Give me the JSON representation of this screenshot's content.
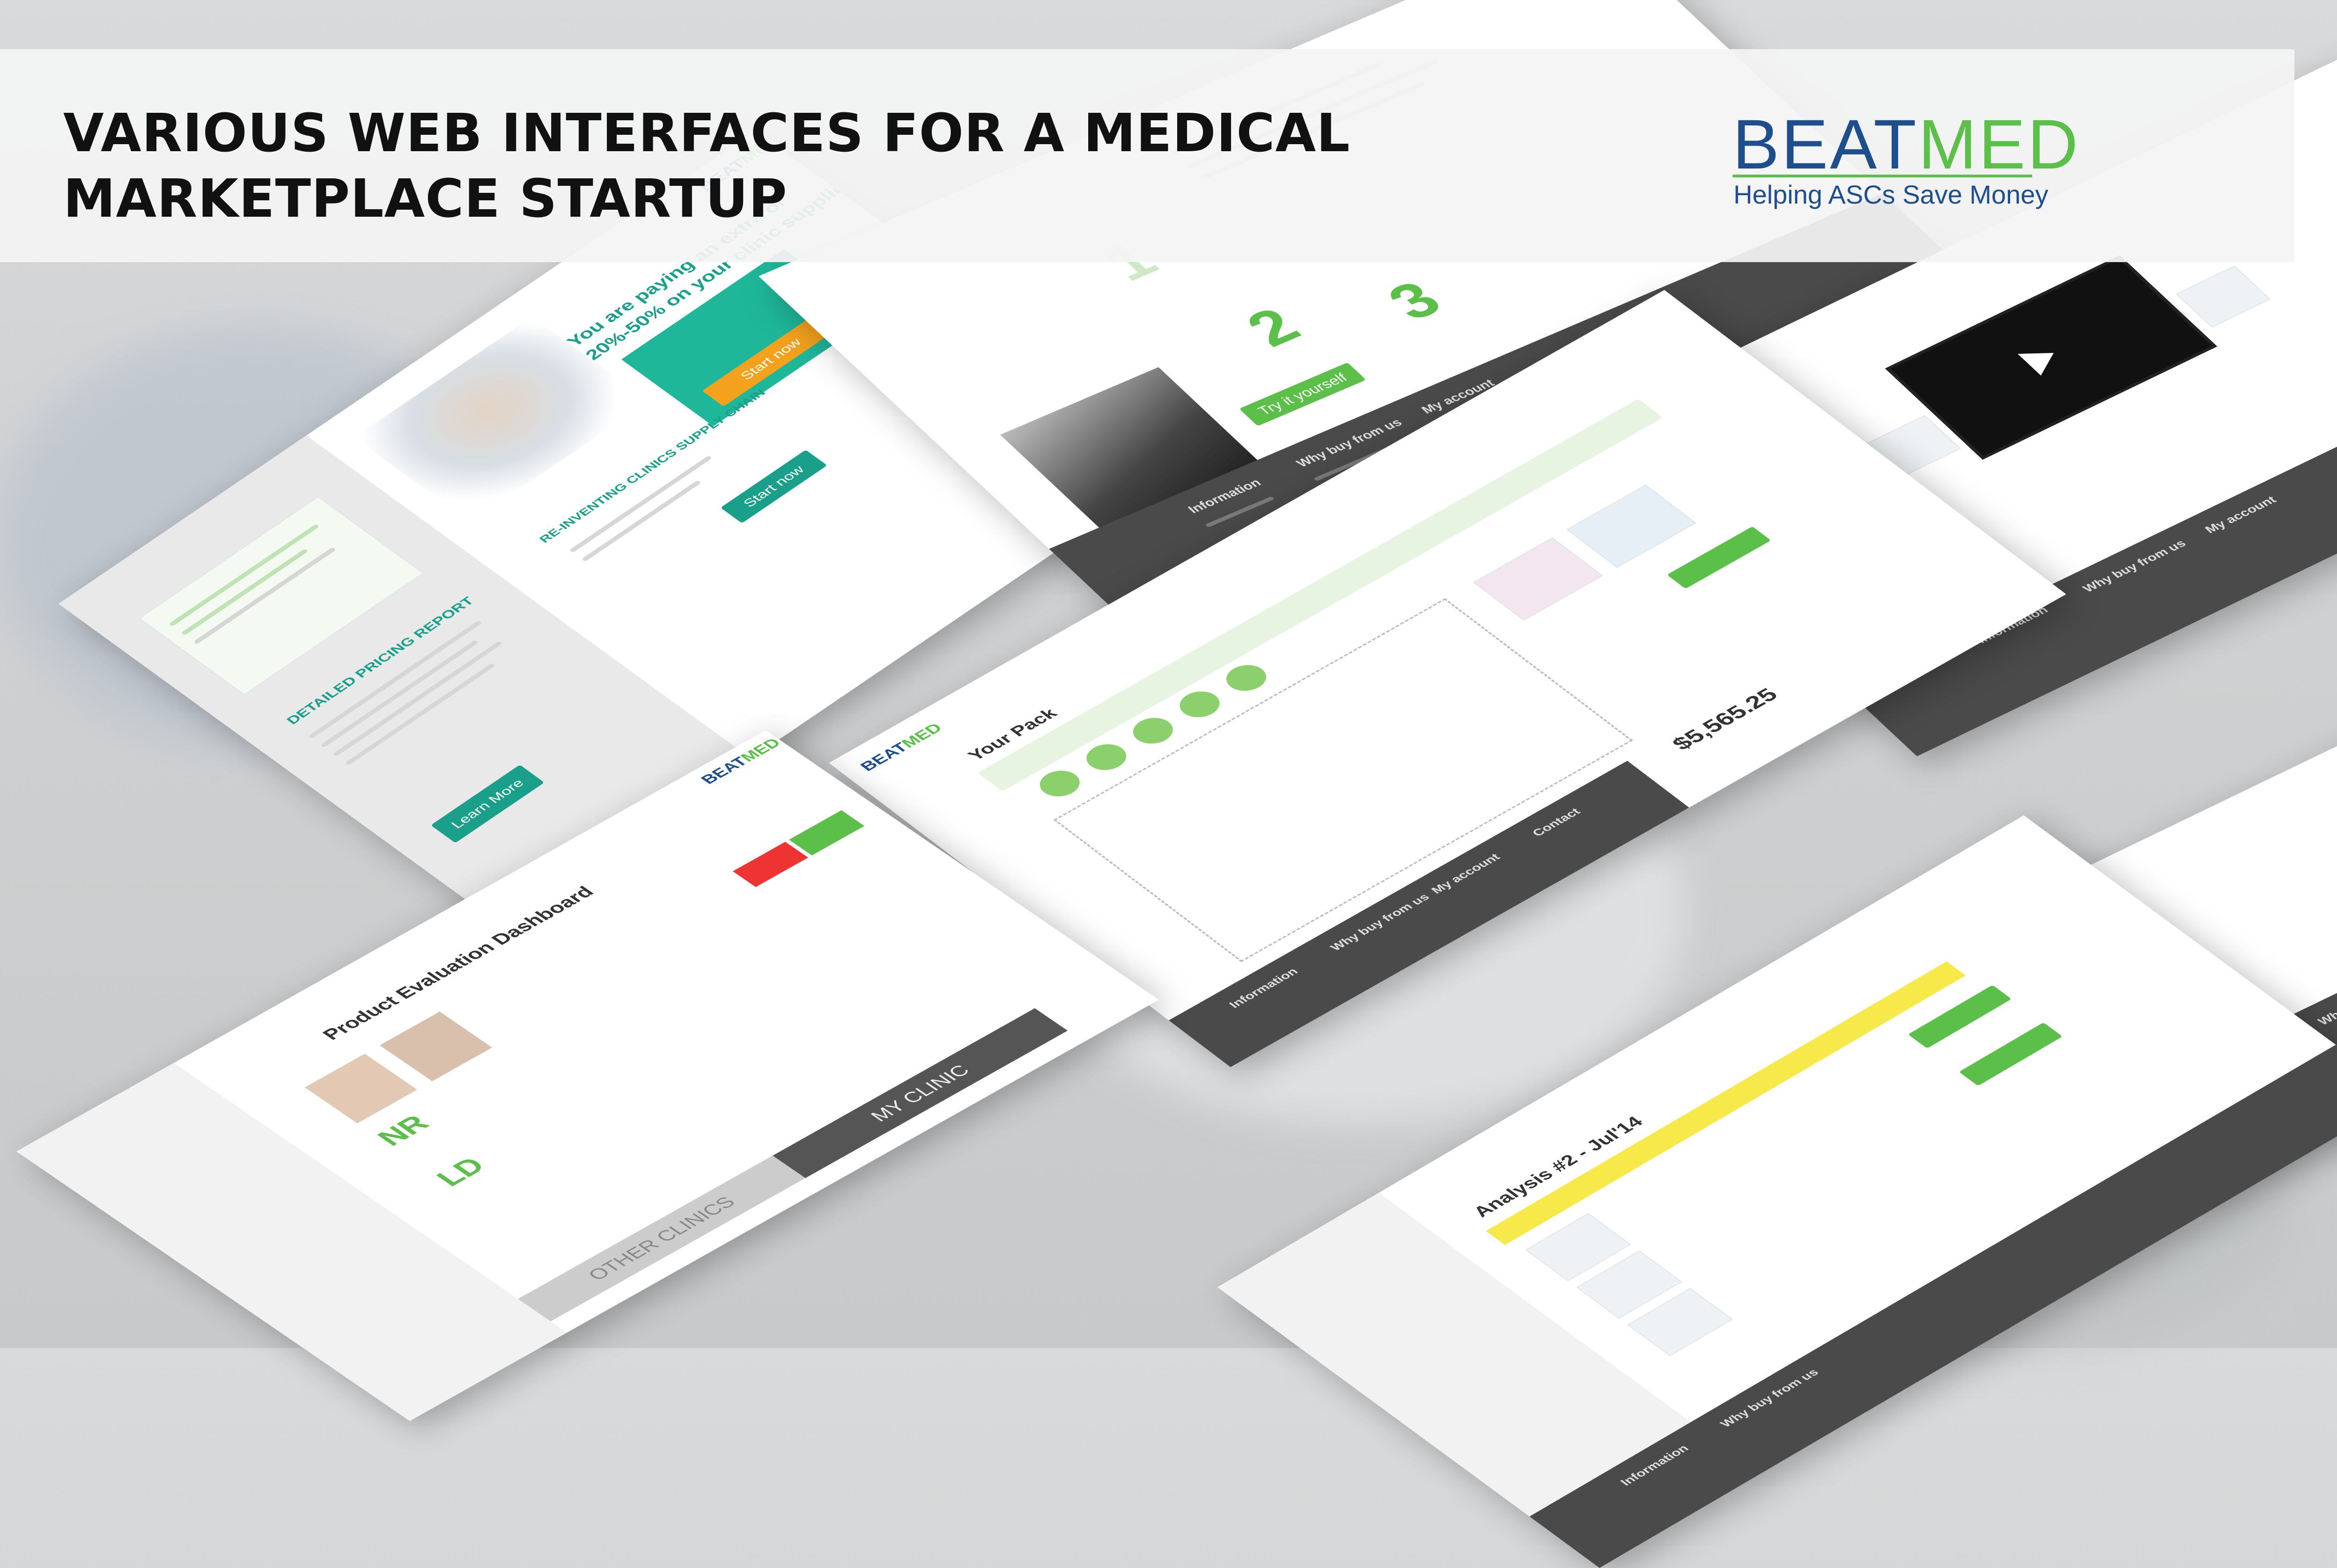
{
  "banner": {
    "title_line1": "VARIOUS WEB INTERFACES FOR A MEDICAL",
    "title_line2": "MARKETPLACE STARTUP"
  },
  "logo": {
    "part1": "BEAT",
    "part2": "MED",
    "tagline": "Helping ASCs Save Money",
    "color_primary": "#1f4e8c",
    "color_accent": "#5bbf4a"
  },
  "mockups": {
    "landing": {
      "headline1": "You are paying an extra  of",
      "headline2": "20%-50% on your clinic supplies!",
      "cta": "Start now",
      "section": "RE-INVENTING CLINICS SUPPLY CHAIN",
      "report": "DETAILED PRICING REPORT",
      "learn_more": "Learn More",
      "start_now": "Start now"
    },
    "how_it_works": {
      "step1": "1",
      "step2": "2",
      "step3": "3",
      "cta": "Try it yourself"
    },
    "pack_builder": {
      "heading": "Your Pack",
      "price": "$5,565.25"
    },
    "evaluation": {
      "heading": "Product Evaluation Dashboard",
      "badge_nr": "NR",
      "badge_ld": "LD",
      "my_clinic": "MY CLINIC",
      "other_clinics": "OTHER CLINICS"
    },
    "analysis": {
      "heading": "Analysis #2 - Jul'14"
    },
    "footer": {
      "information": "Information",
      "why_buy": "Why buy from us",
      "my_account": "My account",
      "contact": "Contact"
    }
  }
}
